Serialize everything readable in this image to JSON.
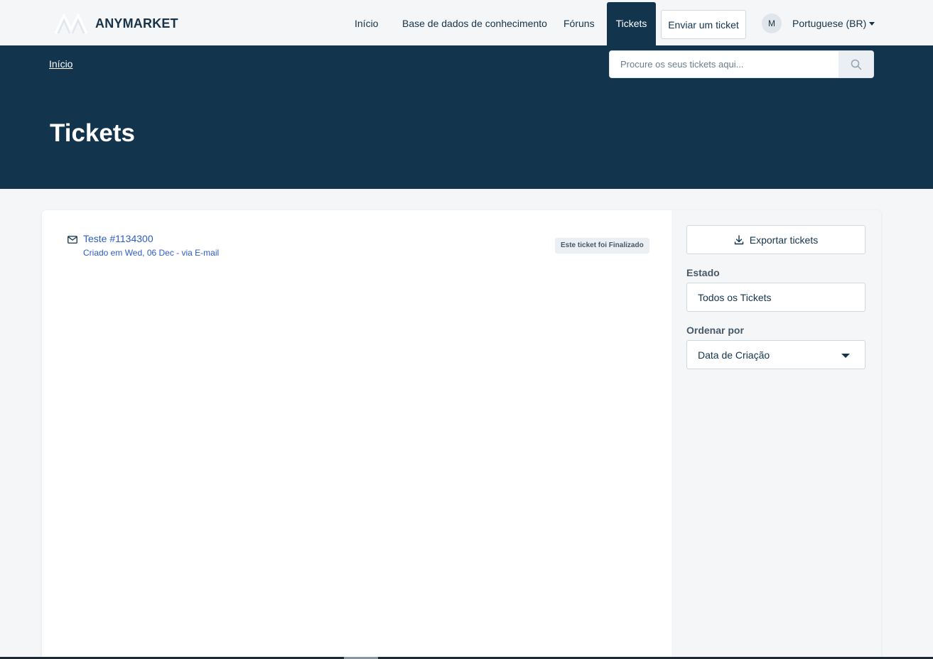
{
  "brand": {
    "name": "ANYMARKET",
    "logo_icon": "anymarket-logo-icon"
  },
  "nav": {
    "items": [
      {
        "label": "Início"
      },
      {
        "label": "Base de dados de conhecimento"
      },
      {
        "label": "Fóruns"
      },
      {
        "label": "Tickets",
        "active": true
      }
    ],
    "submit_ticket": "Enviar um ticket",
    "avatar_initial": "M",
    "language": "Portuguese (BR)"
  },
  "hero": {
    "breadcrumb": "Início",
    "search_placeholder": "Procure os seus tickets aqui...",
    "search_icon": "search-icon",
    "title": "Tickets"
  },
  "tickets": [
    {
      "title": "Teste #1134300",
      "meta": "Criado em Wed, 06 Dec - via E-mail",
      "status": "Este ticket foi Finalizado",
      "icon": "mail-icon"
    }
  ],
  "sidebar": {
    "export_label": "Exportar tickets",
    "export_icon": "download-icon",
    "state_label": "Estado",
    "state_value": "Todos os Tickets",
    "sort_label": "Ordenar por",
    "sort_value": "Data de Criação"
  },
  "colors": {
    "header_bg": "#12344d",
    "link": "#2c5cc5",
    "page_bg": "#f4f6f8"
  }
}
